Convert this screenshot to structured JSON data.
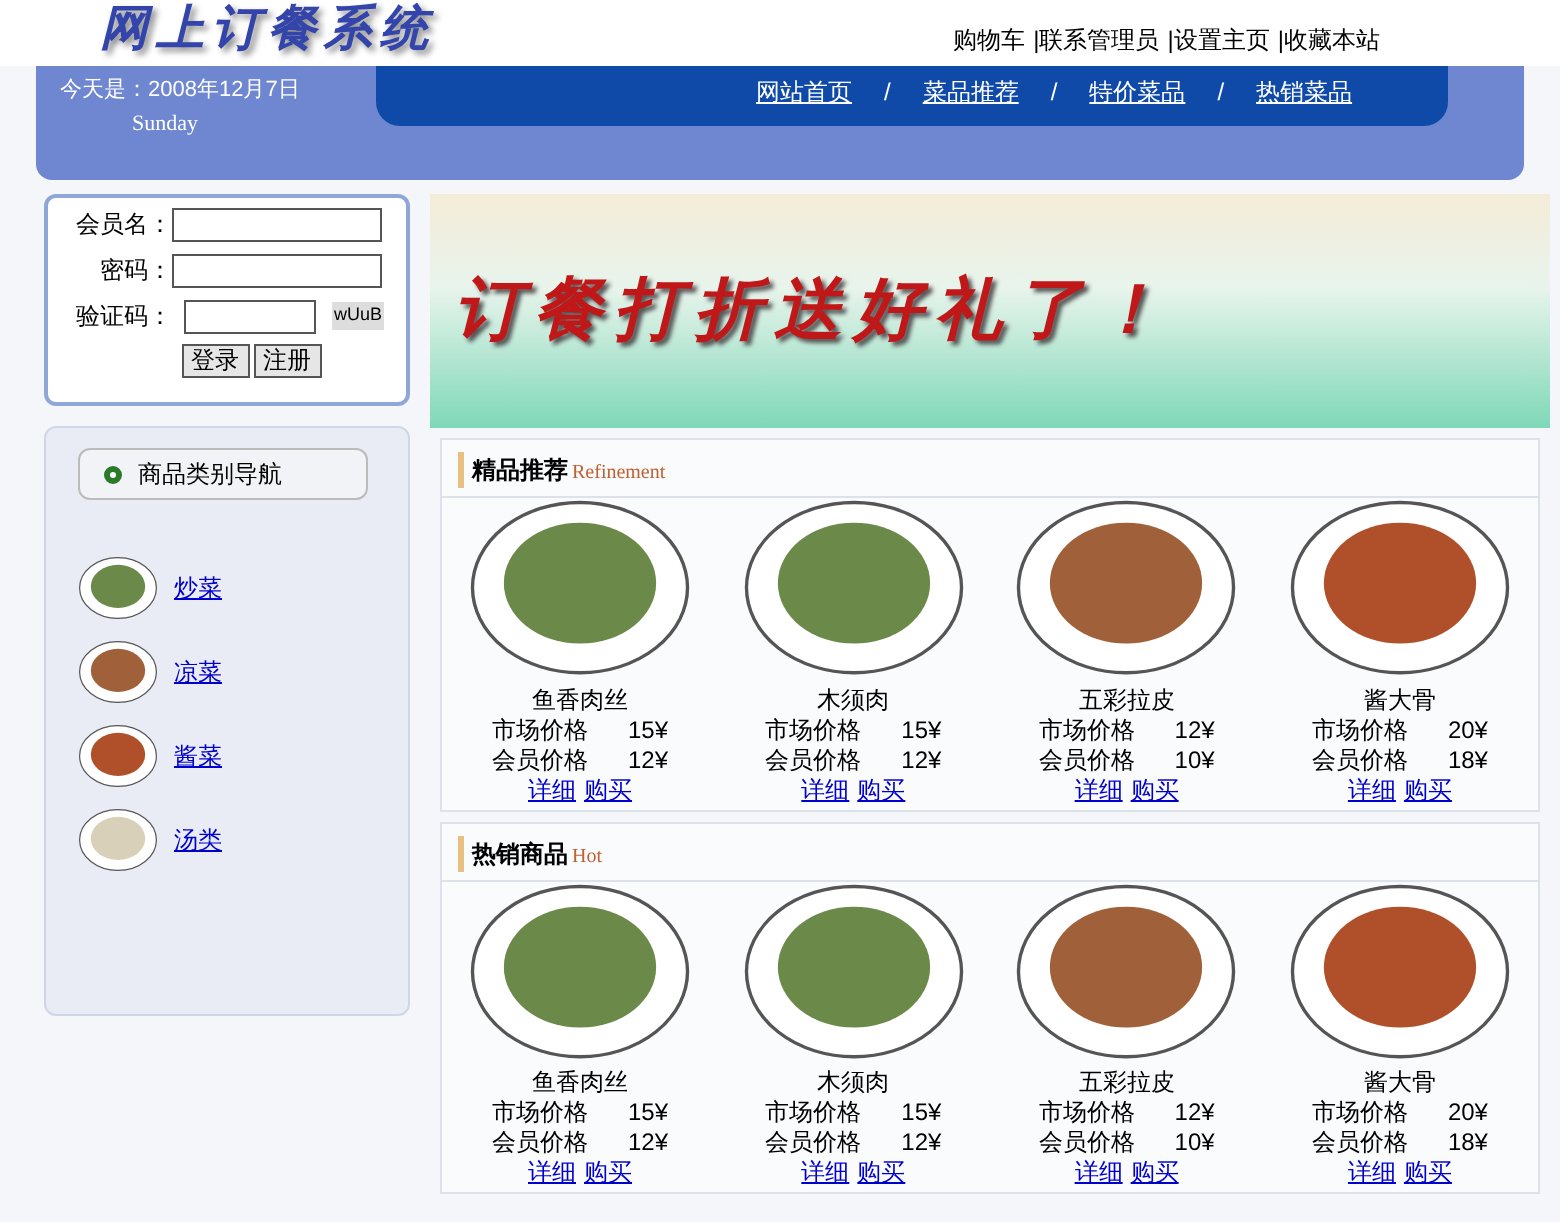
{
  "header": {
    "logo": "网上订餐系统",
    "top_links": [
      "购物车",
      "|联系管理员",
      "|设置主页",
      "|收藏本站"
    ],
    "date": "今天是：2008年12月7日",
    "weekday": "Sunday",
    "nav": [
      {
        "label": "网站首页"
      },
      {
        "label": "菜品推荐"
      },
      {
        "label": "特价菜品"
      },
      {
        "label": "热销菜品"
      }
    ],
    "nav_separator": "/"
  },
  "login": {
    "fields": [
      {
        "label": "会员名：",
        "kind": "text"
      },
      {
        "label": "密码：",
        "kind": "password"
      },
      {
        "label": "验证码：",
        "kind": "captcha",
        "captcha": "wUuB"
      }
    ],
    "buttons": [
      "登录",
      "注册"
    ]
  },
  "category_nav": {
    "title": "商品类别导航",
    "items": [
      {
        "label": "炒菜",
        "color": "#6b8a4a"
      },
      {
        "label": "凉菜",
        "color": "#a0603a"
      },
      {
        "label": "酱菜",
        "color": "#b0502a"
      },
      {
        "label": "汤类",
        "color": "#d8d0b8"
      }
    ]
  },
  "banner": {
    "text": "订餐打折送好礼了！"
  },
  "sections": [
    {
      "title": "精品推荐",
      "subtitle": "Refinement",
      "products": [
        {
          "name": "鱼香肉丝",
          "market_label": "市场价格",
          "market_price": "15¥",
          "member_label": "会员价格",
          "member_price": "12¥",
          "links": [
            "详细",
            "购买"
          ],
          "color": "#6b8a4a"
        },
        {
          "name": "木须肉",
          "market_label": "市场价格",
          "market_price": "15¥",
          "member_label": "会员价格",
          "member_price": "12¥",
          "links": [
            "详细",
            "购买"
          ],
          "color": "#6b8a4a"
        },
        {
          "name": "五彩拉皮",
          "market_label": "市场价格",
          "market_price": "12¥",
          "member_label": "会员价格",
          "member_price": "10¥",
          "links": [
            "详细",
            "购买"
          ],
          "color": "#a0603a"
        },
        {
          "name": "酱大骨",
          "market_label": "市场价格",
          "market_price": "20¥",
          "member_label": "会员价格",
          "member_price": "18¥",
          "links": [
            "详细",
            "购买"
          ],
          "color": "#b0502a"
        }
      ]
    },
    {
      "title": "热销商品",
      "subtitle": "Hot",
      "products": [
        {
          "name": "鱼香肉丝",
          "market_label": "市场价格",
          "market_price": "15¥",
          "member_label": "会员价格",
          "member_price": "12¥",
          "links": [
            "详细",
            "购买"
          ],
          "color": "#6b8a4a"
        },
        {
          "name": "木须肉",
          "market_label": "市场价格",
          "market_price": "15¥",
          "member_label": "会员价格",
          "member_price": "12¥",
          "links": [
            "详细",
            "购买"
          ],
          "color": "#6b8a4a"
        },
        {
          "name": "五彩拉皮",
          "market_label": "市场价格",
          "market_price": "12¥",
          "member_label": "会员价格",
          "member_price": "10¥",
          "links": [
            "详细",
            "购买"
          ],
          "color": "#a0603a"
        },
        {
          "name": "酱大骨",
          "market_label": "市场价格",
          "market_price": "20¥",
          "member_label": "会员价格",
          "member_price": "18¥",
          "links": [
            "详细",
            "购买"
          ],
          "color": "#b0502a"
        }
      ]
    }
  ]
}
